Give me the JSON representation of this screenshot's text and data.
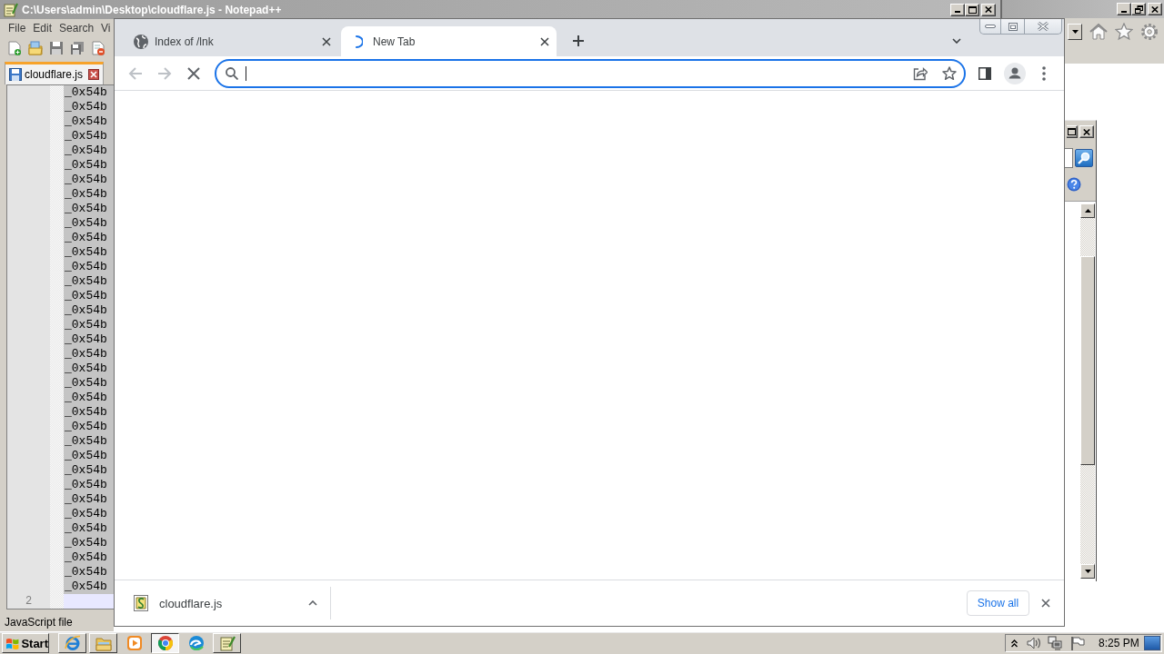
{
  "notepad": {
    "title": "C:\\Users\\admin\\Desktop\\cloudflare.js - Notepad++",
    "menu": [
      "File",
      "Edit",
      "Search",
      "Vi"
    ],
    "tab": "cloudflare.js",
    "rows": [
      {
        "text": "_0x54b",
        "selected": true
      },
      {
        "text": "_0x54b",
        "selected": true
      },
      {
        "text": "_0x54b",
        "selected": true
      },
      {
        "text": "_0x54b",
        "selected": true
      },
      {
        "text": "_0x54b",
        "selected": true
      },
      {
        "text": "_0x54b",
        "selected": true
      },
      {
        "text": "_0x54b",
        "selected": true
      },
      {
        "text": "_0x54b",
        "selected": true
      },
      {
        "text": "_0x54b",
        "selected": true
      },
      {
        "text": "_0x54b",
        "selected": true
      },
      {
        "text": "_0x54b",
        "selected": true
      },
      {
        "text": "_0x54b",
        "selected": true
      },
      {
        "text": "_0x54b",
        "selected": true
      },
      {
        "text": "_0x54b",
        "selected": true
      },
      {
        "text": "_0x54b",
        "selected": true
      },
      {
        "text": "_0x54b",
        "selected": true
      },
      {
        "text": "_0x54b",
        "selected": true
      },
      {
        "text": "_0x54b",
        "selected": true
      },
      {
        "text": "_0x54b",
        "selected": true
      },
      {
        "text": "_0x54b",
        "selected": true
      },
      {
        "text": "_0x54b",
        "selected": true
      },
      {
        "text": "_0x54b",
        "selected": true
      },
      {
        "text": "_0x54b",
        "selected": true
      },
      {
        "text": "_0x54b",
        "selected": true
      },
      {
        "text": "_0x54b",
        "selected": true
      },
      {
        "text": "_0x54b",
        "selected": true
      },
      {
        "text": "_0x54b",
        "selected": true
      },
      {
        "text": "_0x54b",
        "selected": true
      },
      {
        "text": "_0x54b",
        "selected": true
      },
      {
        "text": "_0x54b",
        "selected": true
      },
      {
        "text": "_0x54b",
        "selected": true
      },
      {
        "text": "_0x54b",
        "selected": true
      },
      {
        "text": "_0x54b",
        "selected": true
      },
      {
        "text": "_0x54b",
        "selected": true
      },
      {
        "text": "_0x54b",
        "selected": true
      }
    ],
    "last_line": {
      "number": "2",
      "current": true
    },
    "status": "JavaScript file"
  },
  "browser": {
    "tabs": [
      {
        "title": "Index of /lnk",
        "selected": false,
        "loading": false
      },
      {
        "title": "New Tab",
        "selected": true,
        "loading": true
      }
    ],
    "nav": [
      {
        "kind": "back",
        "disabled": true
      },
      {
        "kind": "forward",
        "disabled": true
      },
      {
        "kind": "stop",
        "disabled": false
      }
    ],
    "omnibox": {
      "focused": true
    },
    "download": {
      "name": "cloudflare.js"
    },
    "show_all": "Show all"
  },
  "taskbar": {
    "start": "Start",
    "buttons": [
      {
        "kind": "ie",
        "running": true,
        "selected": false
      },
      {
        "kind": "folder",
        "running": true,
        "selected": false
      },
      {
        "kind": "media",
        "running": false,
        "selected": false
      },
      {
        "kind": "chrome",
        "running": true,
        "selected": true
      },
      {
        "kind": "edge",
        "running": false,
        "selected": false
      },
      {
        "kind": "notepad",
        "running": true,
        "selected": false
      }
    ],
    "clock": "8:25 PM"
  }
}
